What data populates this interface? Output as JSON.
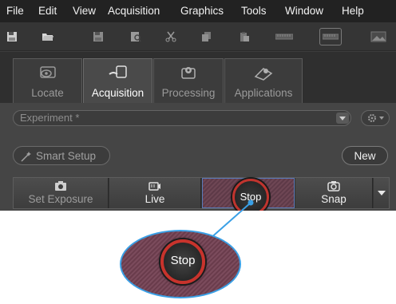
{
  "menu": {
    "items": [
      "File",
      "Edit",
      "View",
      "Acquisition",
      "Graphics",
      "Tools",
      "Window",
      "Help"
    ]
  },
  "toolbar": {
    "icons": [
      "save-icon",
      "open-folder-icon",
      "save-as-icon",
      "print-preview-icon",
      "cut-icon",
      "copy-icon",
      "paste-icon",
      "ruler-icon",
      "ruler-box-icon",
      "image-view-icon"
    ]
  },
  "tabs": [
    {
      "label": "Locate",
      "active": false,
      "icon": "eye-icon"
    },
    {
      "label": "Acquisition",
      "active": true,
      "icon": "acquisition-icon"
    },
    {
      "label": "Processing",
      "active": false,
      "icon": "processing-gear-icon"
    },
    {
      "label": "Applications",
      "active": false,
      "icon": "applications-icon"
    }
  ],
  "experiment": {
    "value": "Experiment *"
  },
  "buttons": {
    "smart_setup": "Smart Setup",
    "new": "New"
  },
  "actions": [
    {
      "label": "Set Exposure",
      "icon": "camera-icon",
      "enabled": false
    },
    {
      "label": "Live",
      "icon": "live-camera-icon",
      "enabled": true
    },
    {
      "label": "Stop",
      "icon": "stop-ring-icon",
      "enabled": true,
      "highlighted": true
    },
    {
      "label": "Snap",
      "icon": "snap-camera-icon",
      "enabled": true
    }
  ],
  "zoom": {
    "label": "Stop"
  },
  "colors": {
    "menubar": "#222222",
    "panel": "#454545",
    "stop_ring": "#c8332c",
    "callout": "#3aa0e6",
    "stop_hatch": "#6e4654"
  }
}
